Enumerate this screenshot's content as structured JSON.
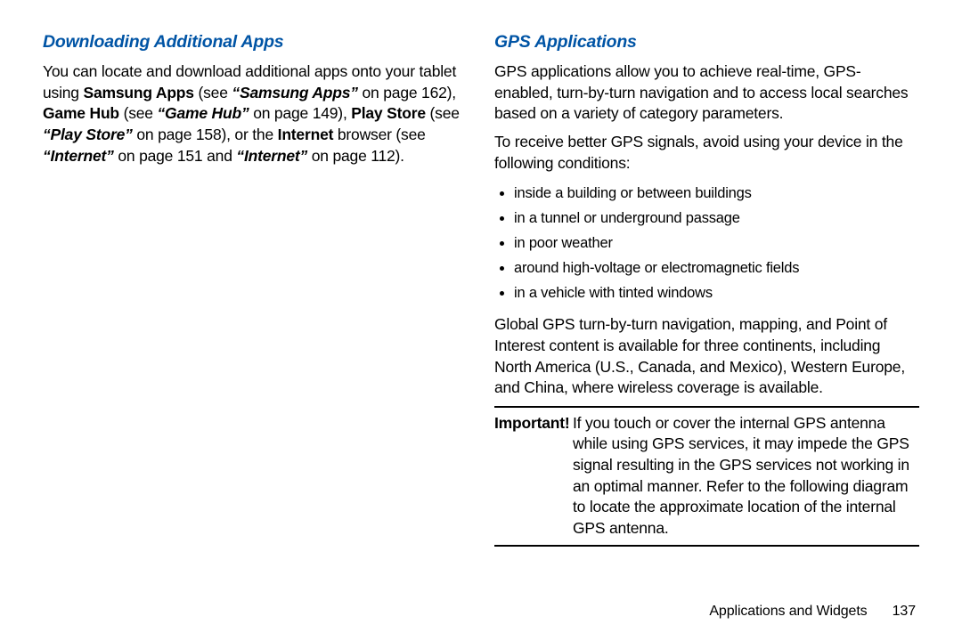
{
  "left": {
    "heading": "Downloading Additional Apps",
    "p1_a": "You can locate and download additional apps onto your tablet using ",
    "p1_b1": "Samsung Apps",
    "p1_c1": " (see ",
    "p1_r1": "“Samsung Apps”",
    "p1_c2": " on page 162), ",
    "p1_b2": "Game Hub",
    "p1_c3": " (see ",
    "p1_r2": "“Game Hub”",
    "p1_c4": " on page 149), ",
    "p1_b3": "Play Store",
    "p1_c5": " (see ",
    "p1_r3": "“Play Store”",
    "p1_c6": " on page 158), or the ",
    "p1_b4": "Internet",
    "p1_c7": " browser (see ",
    "p1_r4": "“Internet”",
    "p1_c8": " on page 151 and ",
    "p1_r5": "“Internet”",
    "p1_c9": " on page 112)."
  },
  "right": {
    "heading": "GPS Applications",
    "p1": "GPS applications allow you to achieve real-time, GPS-enabled, turn-by-turn navigation and to access local searches based on a variety of category parameters.",
    "p2": "To receive better GPS signals, avoid using your device in the following conditions:",
    "bullets": [
      "inside a building or between buildings",
      "in a tunnel or underground passage",
      "in poor weather",
      "around high-voltage or electromagnetic fields",
      "in a vehicle with tinted windows"
    ],
    "p3": "Global GPS turn-by-turn navigation, mapping, and Point of Interest content is available for three continents, including North America (U.S., Canada, and Mexico), Western Europe, and China, where wireless coverage is available.",
    "note_label": "Important!",
    "note_body": "If you touch or cover the internal GPS antenna while using GPS services, it may impede the GPS signal resulting in the GPS services not working in an optimal manner. Refer to the following diagram to locate the approximate location of the internal GPS antenna."
  },
  "footer": {
    "section": "Applications and Widgets",
    "page": "137"
  }
}
